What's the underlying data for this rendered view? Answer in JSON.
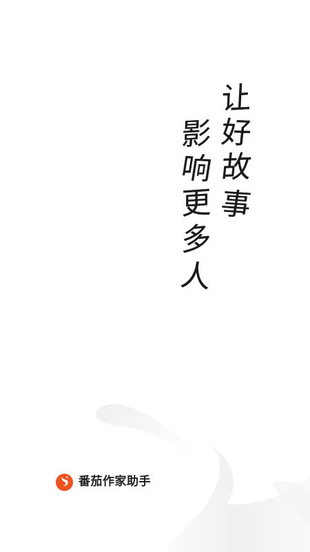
{
  "slogan": {
    "column_1": [
      "让",
      "好",
      "故",
      "事"
    ],
    "column_2": [
      "影",
      "响",
      "更",
      "多",
      "人"
    ],
    "ink_color": "#1a1a1a"
  },
  "brand": {
    "name": "番茄作家助手",
    "logo_icon": "tomato-flame-logo-icon",
    "logo_color": "#f2521c"
  },
  "background": {
    "color": "#ffffff",
    "decoration": "gray-brush-swoosh"
  }
}
